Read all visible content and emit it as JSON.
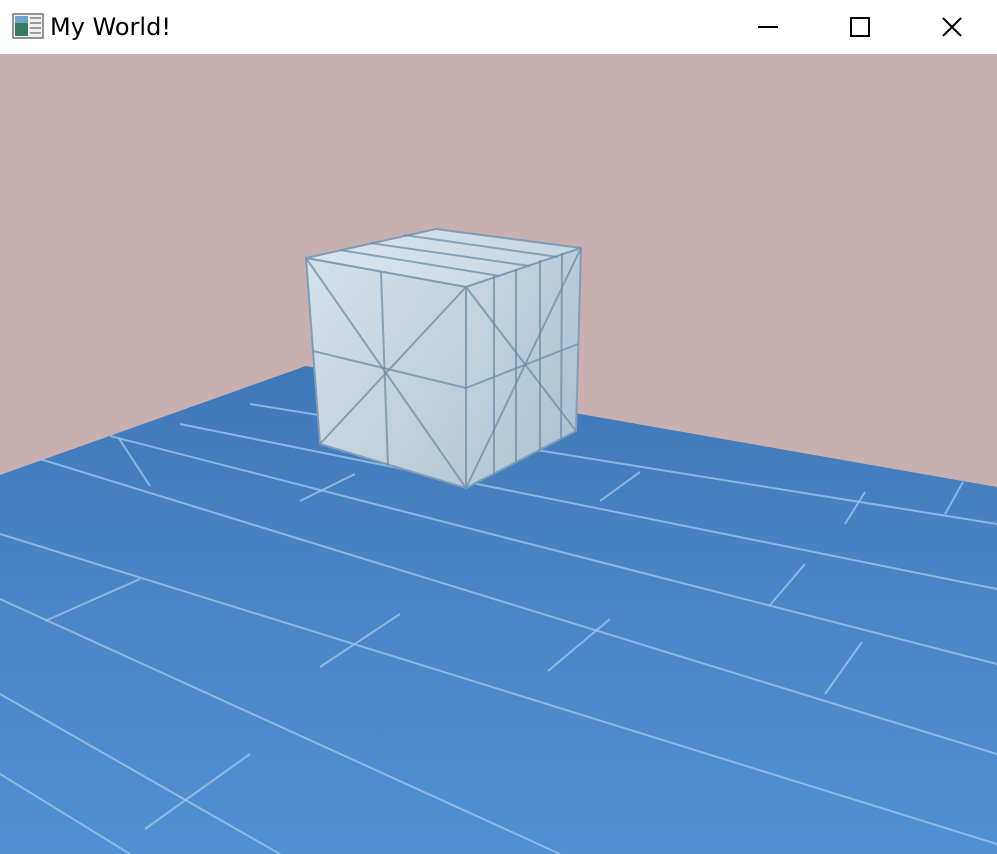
{
  "window": {
    "title": "My World!",
    "controls": {
      "minimize": "minimize-icon",
      "maximize": "maximize-icon",
      "close": "close-icon"
    }
  },
  "scene": {
    "sky_color": "#c9b0b0",
    "floor_color": "#4a86c8",
    "plank_line_color": "#9cc4ea",
    "cube_color": "#c6d6e2",
    "cube_edge_color": "#6e8ea6"
  }
}
